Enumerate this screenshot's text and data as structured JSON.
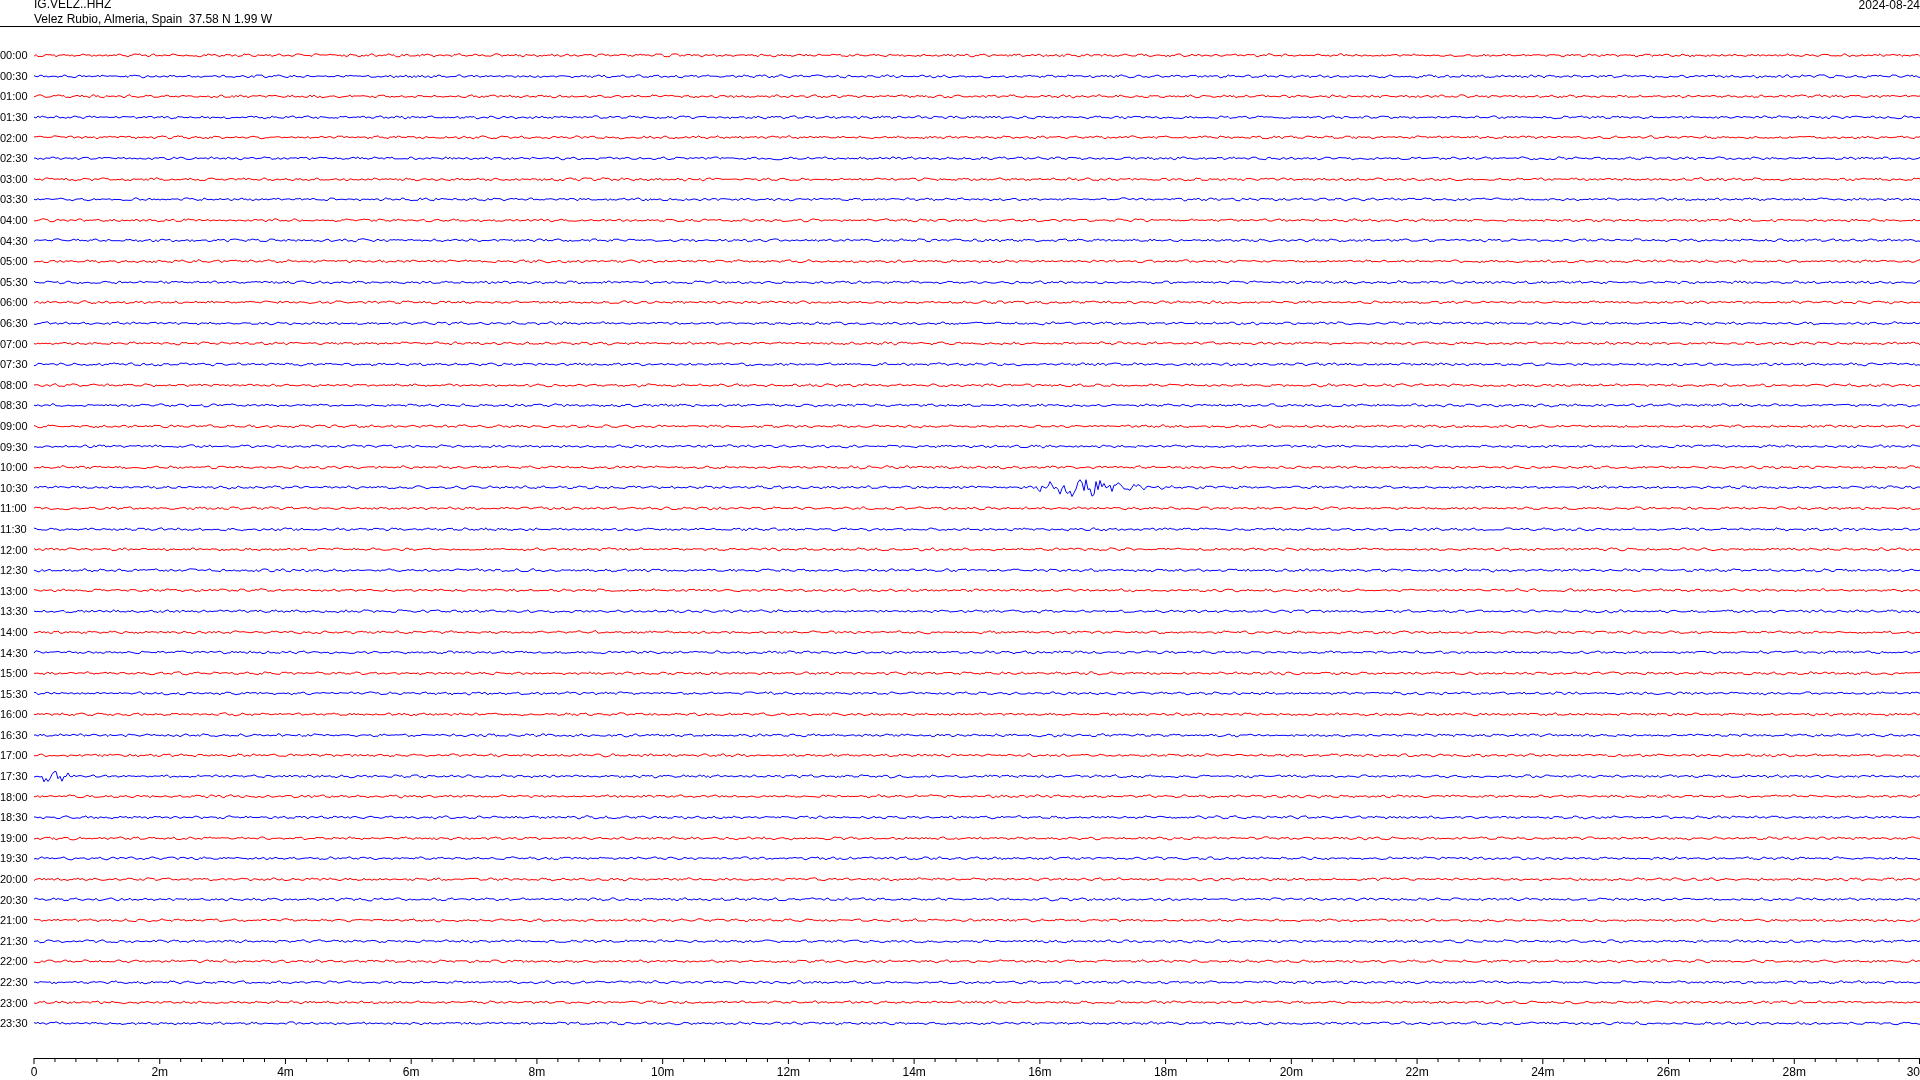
{
  "header": {
    "station": "IG.VELZ..HHZ",
    "location": "Velez Rubio, Almeria, Spain  37.58 N 1.99 W",
    "date": "2024-08-24"
  },
  "traces": [
    {
      "time": "00:00",
      "color": "#ff0000"
    },
    {
      "time": "00:30",
      "color": "#0000ff"
    },
    {
      "time": "01:00",
      "color": "#ff0000"
    },
    {
      "time": "01:30",
      "color": "#0000ff"
    },
    {
      "time": "02:00",
      "color": "#ff0000"
    },
    {
      "time": "02:30",
      "color": "#0000ff"
    },
    {
      "time": "03:00",
      "color": "#ff0000"
    },
    {
      "time": "03:30",
      "color": "#0000ff"
    },
    {
      "time": "04:00",
      "color": "#ff0000"
    },
    {
      "time": "04:30",
      "color": "#0000ff"
    },
    {
      "time": "05:00",
      "color": "#ff0000"
    },
    {
      "time": "05:30",
      "color": "#0000ff"
    },
    {
      "time": "06:00",
      "color": "#ff0000"
    },
    {
      "time": "06:30",
      "color": "#0000ff"
    },
    {
      "time": "07:00",
      "color": "#ff0000"
    },
    {
      "time": "07:30",
      "color": "#0000ff"
    },
    {
      "time": "08:00",
      "color": "#ff0000"
    },
    {
      "time": "08:30",
      "color": "#0000ff"
    },
    {
      "time": "09:00",
      "color": "#ff0000"
    },
    {
      "time": "09:30",
      "color": "#0000ff"
    },
    {
      "time": "10:00",
      "color": "#ff0000"
    },
    {
      "time": "10:30",
      "color": "#0000ff"
    },
    {
      "time": "11:00",
      "color": "#ff0000"
    },
    {
      "time": "11:30",
      "color": "#0000ff"
    },
    {
      "time": "12:00",
      "color": "#ff0000"
    },
    {
      "time": "12:30",
      "color": "#0000ff"
    },
    {
      "time": "13:00",
      "color": "#ff0000"
    },
    {
      "time": "13:30",
      "color": "#0000ff"
    },
    {
      "time": "14:00",
      "color": "#ff0000"
    },
    {
      "time": "14:30",
      "color": "#0000ff"
    },
    {
      "time": "15:00",
      "color": "#ff0000"
    },
    {
      "time": "15:30",
      "color": "#0000ff"
    },
    {
      "time": "16:00",
      "color": "#ff0000"
    },
    {
      "time": "16:30",
      "color": "#0000ff"
    },
    {
      "time": "17:00",
      "color": "#ff0000"
    },
    {
      "time": "17:30",
      "color": "#0000ff"
    },
    {
      "time": "18:00",
      "color": "#ff0000"
    },
    {
      "time": "18:30",
      "color": "#0000ff"
    },
    {
      "time": "19:00",
      "color": "#ff0000"
    },
    {
      "time": "19:30",
      "color": "#0000ff"
    },
    {
      "time": "20:00",
      "color": "#ff0000"
    },
    {
      "time": "20:30",
      "color": "#0000ff"
    },
    {
      "time": "21:00",
      "color": "#ff0000"
    },
    {
      "time": "21:30",
      "color": "#0000ff"
    },
    {
      "time": "22:00",
      "color": "#ff0000"
    },
    {
      "time": "22:30",
      "color": "#0000ff"
    },
    {
      "time": "23:00",
      "color": "#ff0000"
    },
    {
      "time": "23:30",
      "color": "#0000ff"
    }
  ],
  "x_axis": {
    "labels": [
      "0",
      "2m",
      "4m",
      "6m",
      "8m",
      "10m",
      "12m",
      "14m",
      "16m",
      "18m",
      "20m",
      "22m",
      "24m",
      "26m",
      "28m",
      "30"
    ]
  }
}
